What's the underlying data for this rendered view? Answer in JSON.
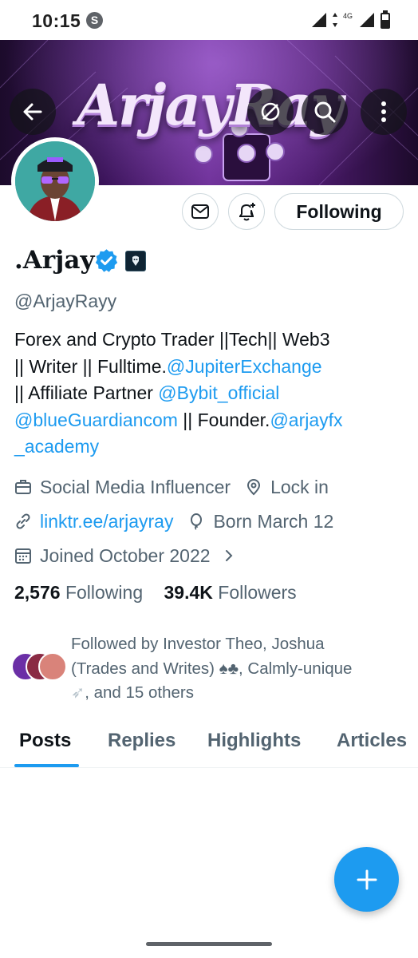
{
  "status_bar": {
    "time": "10:15",
    "s_badge": "S",
    "network": "4G"
  },
  "banner": {
    "title": "ArjayRay"
  },
  "profile": {
    "display_name": ".Arjay",
    "handle": "@ArjayRayy",
    "follow_button": "Following",
    "bio": {
      "line1": "Forex and Crypto Trader ||Tech|| Web3",
      "line2_text": "|| Writer || Fulltime.",
      "line2_link": "@JupiterExchange",
      "line3_text": "|| Affiliate Partner ",
      "line3_link": "@Bybit_official",
      "line4_link": "@blueGuardiancom",
      "line4_text": " || Founder.",
      "line4_link2": "@arjayfx",
      "line5_link": "_academy"
    },
    "category": "Social Media Influencer",
    "location": "Lock in",
    "website": "linktr.ee/arjayray",
    "birthday": "Born March 12",
    "joined": "Joined October 2022",
    "following_count": "2,576",
    "following_label": "Following",
    "followers_count": "39.4K",
    "followers_label": "Followers",
    "followed_by": {
      "line1": "Followed by Investor Theo, Joshua",
      "line2": "(Trades and Writes) ♠♣, Calmly-unique",
      "line3": ", and 15 others"
    }
  },
  "tabs": [
    {
      "label": "Posts",
      "active": true
    },
    {
      "label": "Replies",
      "active": false
    },
    {
      "label": "Highlights",
      "active": false
    },
    {
      "label": "Articles",
      "active": false
    }
  ],
  "colors": {
    "accent": "#1d9bf0",
    "text": "#0f1419",
    "muted": "#536471",
    "border": "#cfd9de"
  },
  "icons": [
    "back-arrow-icon",
    "no-translate-icon",
    "search-icon",
    "more-vertical-icon",
    "mail-icon",
    "bell-plus-icon",
    "verified-badge-icon",
    "briefcase-icon",
    "location-pin-icon",
    "link-icon",
    "balloon-icon",
    "calendar-icon",
    "chevron-right-icon",
    "plus-icon"
  ]
}
